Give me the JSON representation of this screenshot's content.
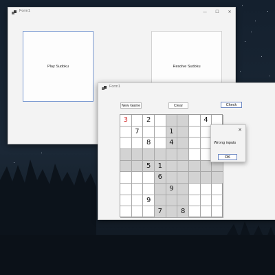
{
  "main_window": {
    "title": "Form1",
    "controls": {
      "minimize": "—",
      "maximize": "☐",
      "close": "✕"
    },
    "buttons": {
      "play": "Play Sudoku",
      "resolve": "Resolve Sudoku"
    }
  },
  "game_window": {
    "title": "Form1",
    "buttons": {
      "new_game": "New Game",
      "clear": "Clear",
      "check": "Check"
    },
    "grid": [
      [
        "3",
        "",
        "2",
        "",
        "",
        "",
        "",
        "4",
        ""
      ],
      [
        "",
        "7",
        "",
        "",
        "1",
        "",
        "",
        "",
        ""
      ],
      [
        "",
        "",
        "8",
        "",
        "4",
        "",
        "",
        "",
        ""
      ],
      [
        "",
        "",
        "",
        "",
        "",
        "",
        "",
        "",
        ""
      ],
      [
        "",
        "",
        "5",
        "1",
        "",
        "",
        "",
        "",
        ""
      ],
      [
        "",
        "",
        "",
        "6",
        "",
        "",
        "",
        "",
        ""
      ],
      [
        "",
        "",
        "",
        "",
        "9",
        "",
        "",
        "",
        ""
      ],
      [
        "",
        "",
        "9",
        "",
        "",
        "",
        "",
        "",
        ""
      ],
      [
        "",
        "",
        "",
        "7",
        "",
        "8",
        "",
        "",
        ""
      ]
    ],
    "error_cells": [
      "0-0"
    ]
  },
  "dialog": {
    "close": "✕",
    "message": "Wrong inputs",
    "ok": "OK"
  }
}
